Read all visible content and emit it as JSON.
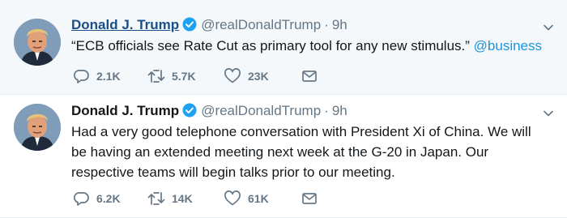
{
  "tweets": [
    {
      "name": "Donald J. Trump",
      "handle": "@realDonaldTrump",
      "separator": "·",
      "time": "9h",
      "text": "“ECB officials see Rate Cut as primary tool for any new stimulus.” ",
      "mention": "@business",
      "replies": "2.1K",
      "retweets": "5.7K",
      "likes": "23K"
    },
    {
      "name": "Donald J. Trump",
      "handle": "@realDonaldTrump",
      "separator": "·",
      "time": "9h",
      "text": "Had a very good telephone conversation with President Xi of China. We will be having an extended meeting next week at the G-20 in Japan. Our respective teams will begin talks prior to our meeting.",
      "replies": "6.2K",
      "retweets": "14K",
      "likes": "61K"
    }
  ],
  "icons": {
    "verified": "verified-badge-icon",
    "reply": "reply-bubble-icon",
    "retweet": "retweet-arrows-icon",
    "like": "heart-icon",
    "dm": "envelope-icon",
    "menu": "chevron-down-icon"
  },
  "colors": {
    "accent": "#1b95e0",
    "name_link": "#1b4f8a",
    "muted": "#657786",
    "text": "#14171a",
    "selected_background": "#f5f8fa"
  }
}
